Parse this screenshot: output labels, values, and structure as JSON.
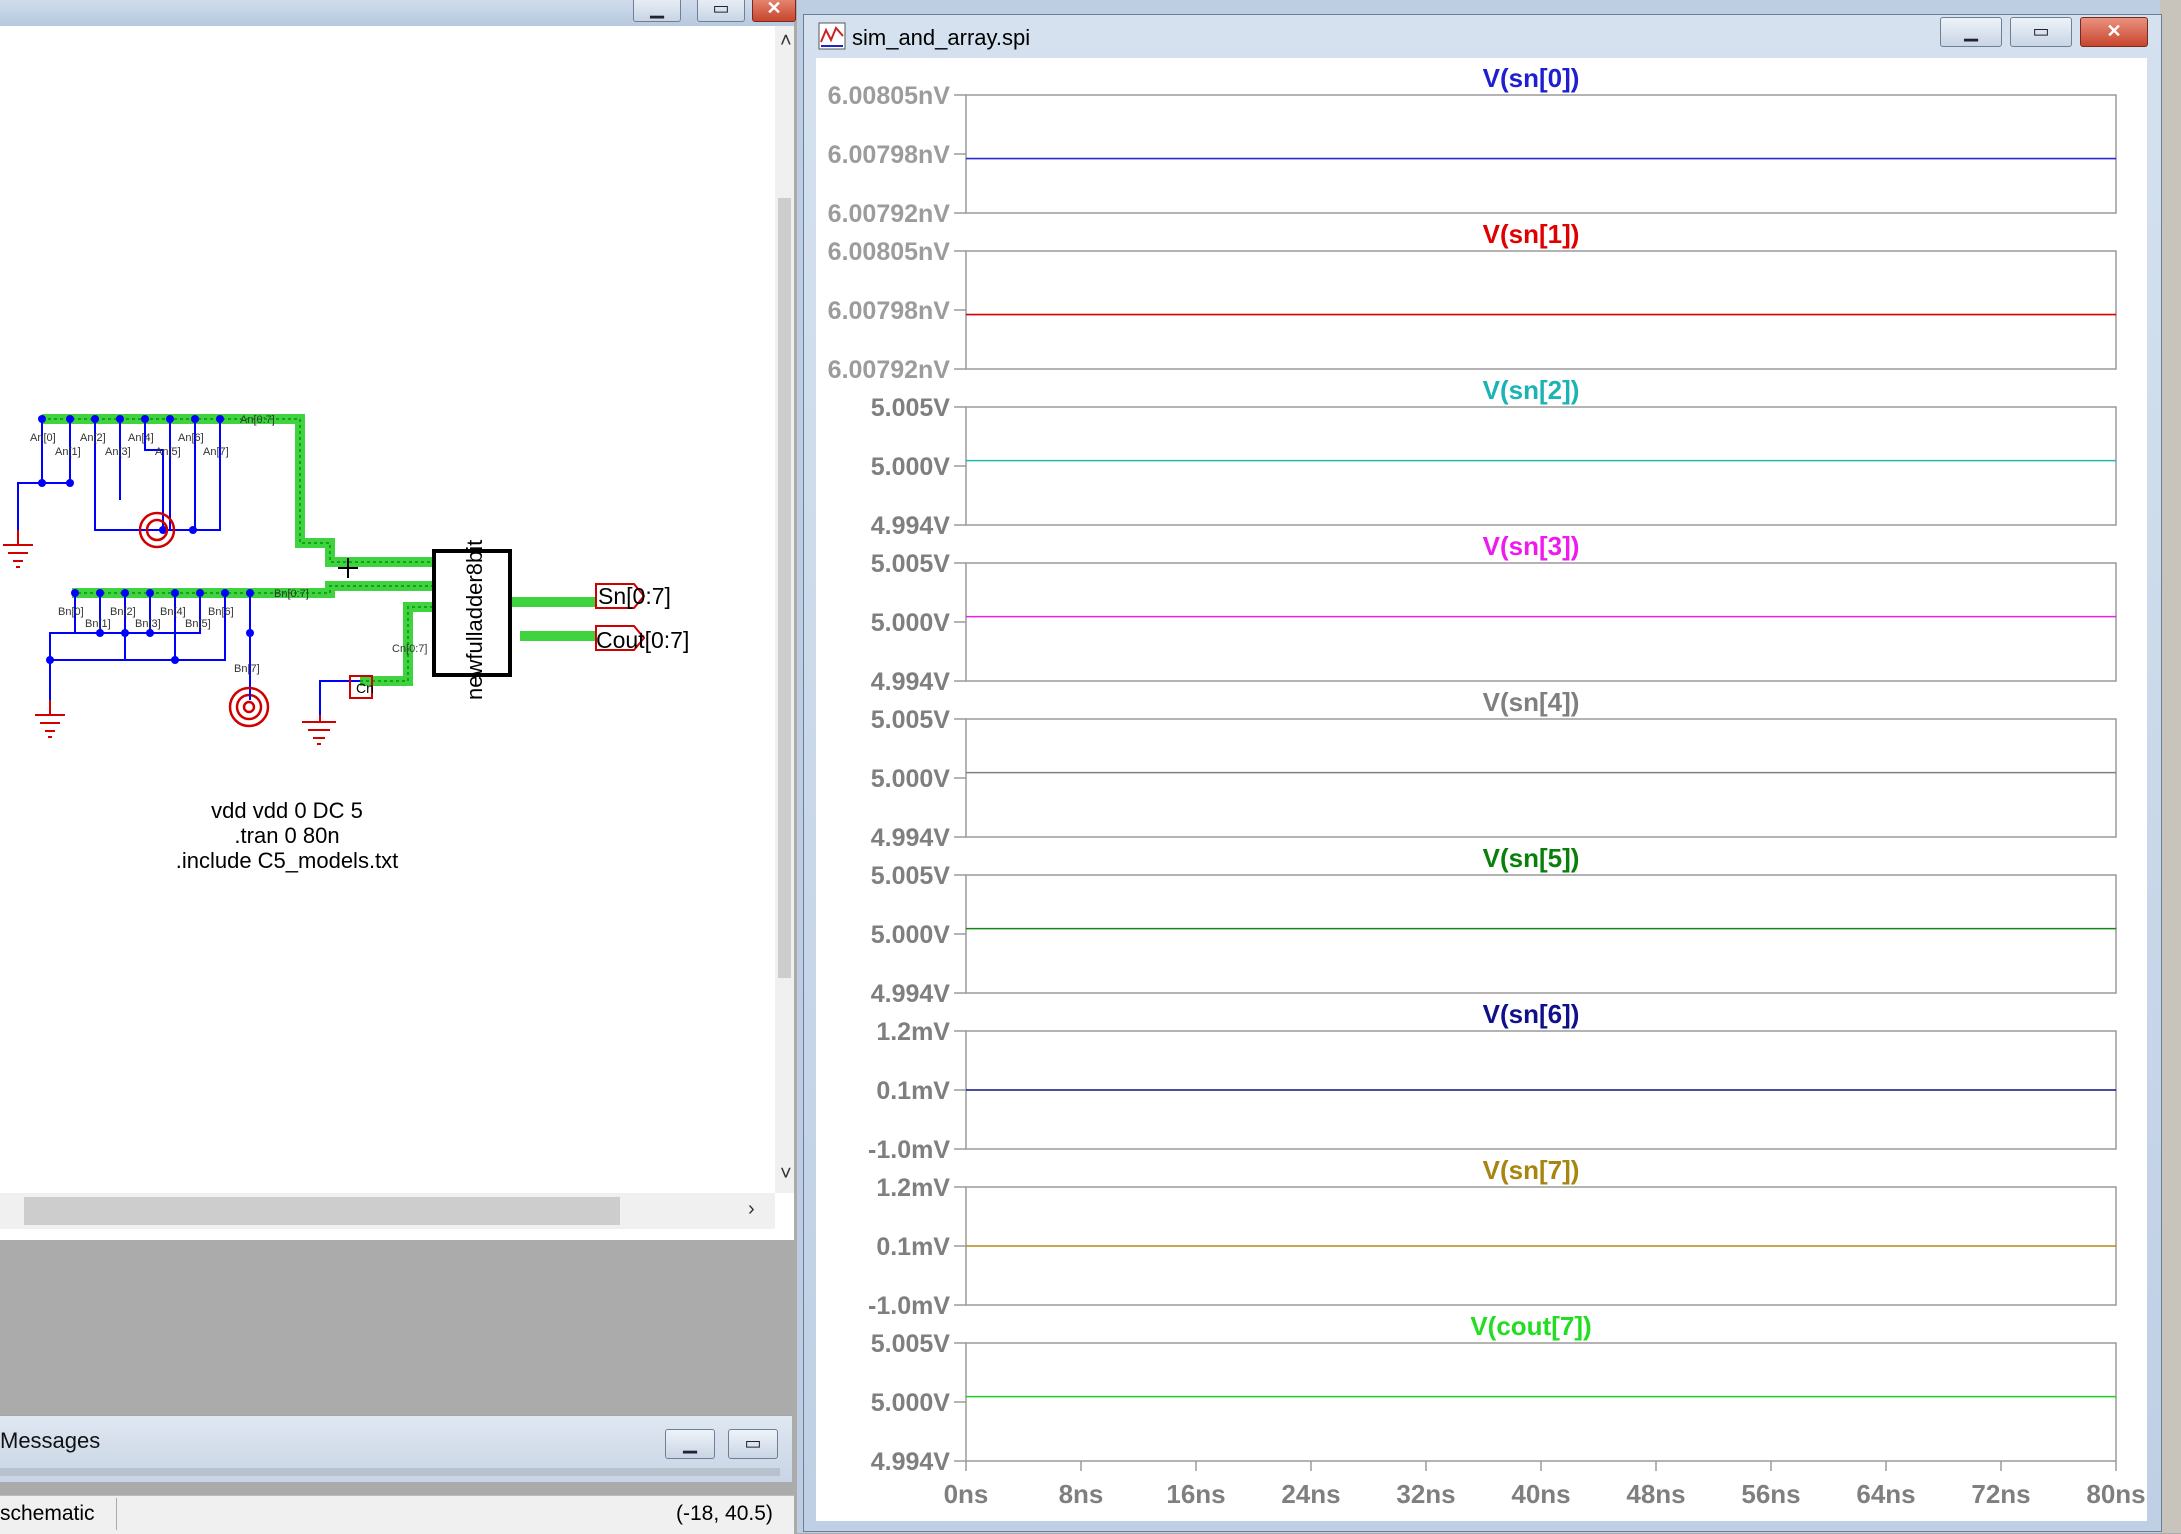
{
  "schematic": {
    "directive_lines": [
      "vdd vdd 0 DC 5",
      ".tran 0 80n",
      ".include C5_models.txt"
    ],
    "component_label": "newfulladder8bit",
    "output_pins": [
      "Sn[0:7]",
      "Cout[0:7]"
    ],
    "net_labels_a": [
      "An[0]",
      "An[1]",
      "An[2]",
      "An[3]",
      "An[4]",
      "An[5]",
      "An[6]",
      "An[7]"
    ],
    "net_labels_b": [
      "Bn[0]",
      "Bn[1]",
      "Bn[2]",
      "Bn[3]",
      "Bn[4]",
      "Bn[5]",
      "Bn[6]",
      "Bn[7]"
    ],
    "carry_label": "Cn[0:7]"
  },
  "messages": {
    "title": "Messages"
  },
  "status": {
    "left": "schematic",
    "coord": "(-18, 40.5)"
  },
  "plot_window": {
    "title": "sim_and_array.spi",
    "icon": "waveform-icon"
  },
  "colors": {
    "green_bus": "#3fd33f",
    "wire_blue": "#0000ff",
    "ground_red": "#d00000",
    "title_blue_bar": "#c5d5ea"
  },
  "chart_data": [
    {
      "type": "line",
      "title": "V(sn[0])",
      "title_color": "#1f1fd1",
      "ytick_labels": [
        "6.00805nV",
        "6.00798nV",
        "6.00792nV"
      ],
      "ylim": [
        6.00792,
        6.00805
      ],
      "series": [
        {
          "name": "V(sn[0])",
          "x": [
            0,
            80
          ],
          "y": [
            6.00798,
            6.00798
          ],
          "color": "#2a2ad0"
        }
      ]
    },
    {
      "type": "line",
      "title": "V(sn[1])",
      "title_color": "#e00000",
      "ytick_labels": [
        "6.00805nV",
        "6.00798nV",
        "6.00792nV"
      ],
      "ylim": [
        6.00792,
        6.00805
      ],
      "series": [
        {
          "name": "V(sn[1])",
          "x": [
            0,
            80
          ],
          "y": [
            6.00798,
            6.00798
          ],
          "color": "#d80000"
        }
      ]
    },
    {
      "type": "line",
      "title": "V(sn[2])",
      "title_color": "#1ab4b4",
      "ytick_labels": [
        "5.005V",
        "5.000V",
        "4.994V"
      ],
      "ylim": [
        4.994,
        5.005
      ],
      "series": [
        {
          "name": "V(sn[2])",
          "x": [
            0,
            80
          ],
          "y": [
            5.0,
            5.0
          ],
          "color": "#20b8b8"
        }
      ]
    },
    {
      "type": "line",
      "title": "V(sn[3])",
      "title_color": "#ee1aee",
      "ytick_labels": [
        "5.005V",
        "5.000V",
        "4.994V"
      ],
      "ylim": [
        4.994,
        5.005
      ],
      "series": [
        {
          "name": "V(sn[3])",
          "x": [
            0,
            80
          ],
          "y": [
            5.0,
            5.0
          ],
          "color": "#e820e8"
        }
      ]
    },
    {
      "type": "line",
      "title": "V(sn[4])",
      "title_color": "#7f7f7f",
      "ytick_labels": [
        "5.005V",
        "5.000V",
        "4.994V"
      ],
      "ylim": [
        4.994,
        5.005
      ],
      "series": [
        {
          "name": "V(sn[4])",
          "x": [
            0,
            80
          ],
          "y": [
            5.0,
            5.0
          ],
          "color": "#808080"
        }
      ]
    },
    {
      "type": "line",
      "title": "V(sn[5])",
      "title_color": "#0a800a",
      "ytick_labels": [
        "5.005V",
        "5.000V",
        "4.994V"
      ],
      "ylim": [
        4.994,
        5.005
      ],
      "series": [
        {
          "name": "V(sn[5])",
          "x": [
            0,
            80
          ],
          "y": [
            5.0,
            5.0
          ],
          "color": "#118811"
        }
      ]
    },
    {
      "type": "line",
      "title": "V(sn[6])",
      "title_color": "#10108a",
      "ytick_labels": [
        "1.2mV",
        "0.1mV",
        "-1.0mV"
      ],
      "ylim": [
        -1.0,
        1.2
      ],
      "series": [
        {
          "name": "V(sn[6])",
          "x": [
            0,
            80
          ],
          "y": [
            0.1,
            0.1
          ],
          "color": "#101080"
        }
      ]
    },
    {
      "type": "line",
      "title": "V(sn[7])",
      "title_color": "#a88410",
      "ytick_labels": [
        "1.2mV",
        "0.1mV",
        "-1.0mV"
      ],
      "ylim": [
        -1.0,
        1.2
      ],
      "series": [
        {
          "name": "V(sn[7])",
          "x": [
            0,
            80
          ],
          "y": [
            0.1,
            0.1
          ],
          "color": "#b08a10"
        }
      ]
    },
    {
      "type": "line",
      "title": "V(cout[7])",
      "title_color": "#22dd22",
      "ytick_labels": [
        "5.005V",
        "5.000V",
        "4.994V"
      ],
      "ylim": [
        4.994,
        5.005
      ],
      "xtick_labels": [
        "0ns",
        "8ns",
        "16ns",
        "24ns",
        "32ns",
        "40ns",
        "48ns",
        "56ns",
        "64ns",
        "72ns",
        "80ns"
      ],
      "xlim": [
        0,
        80
      ],
      "series": [
        {
          "name": "V(cout[7])",
          "x": [
            0,
            80
          ],
          "y": [
            5.0,
            5.0
          ],
          "color": "#22cc22"
        }
      ]
    }
  ]
}
